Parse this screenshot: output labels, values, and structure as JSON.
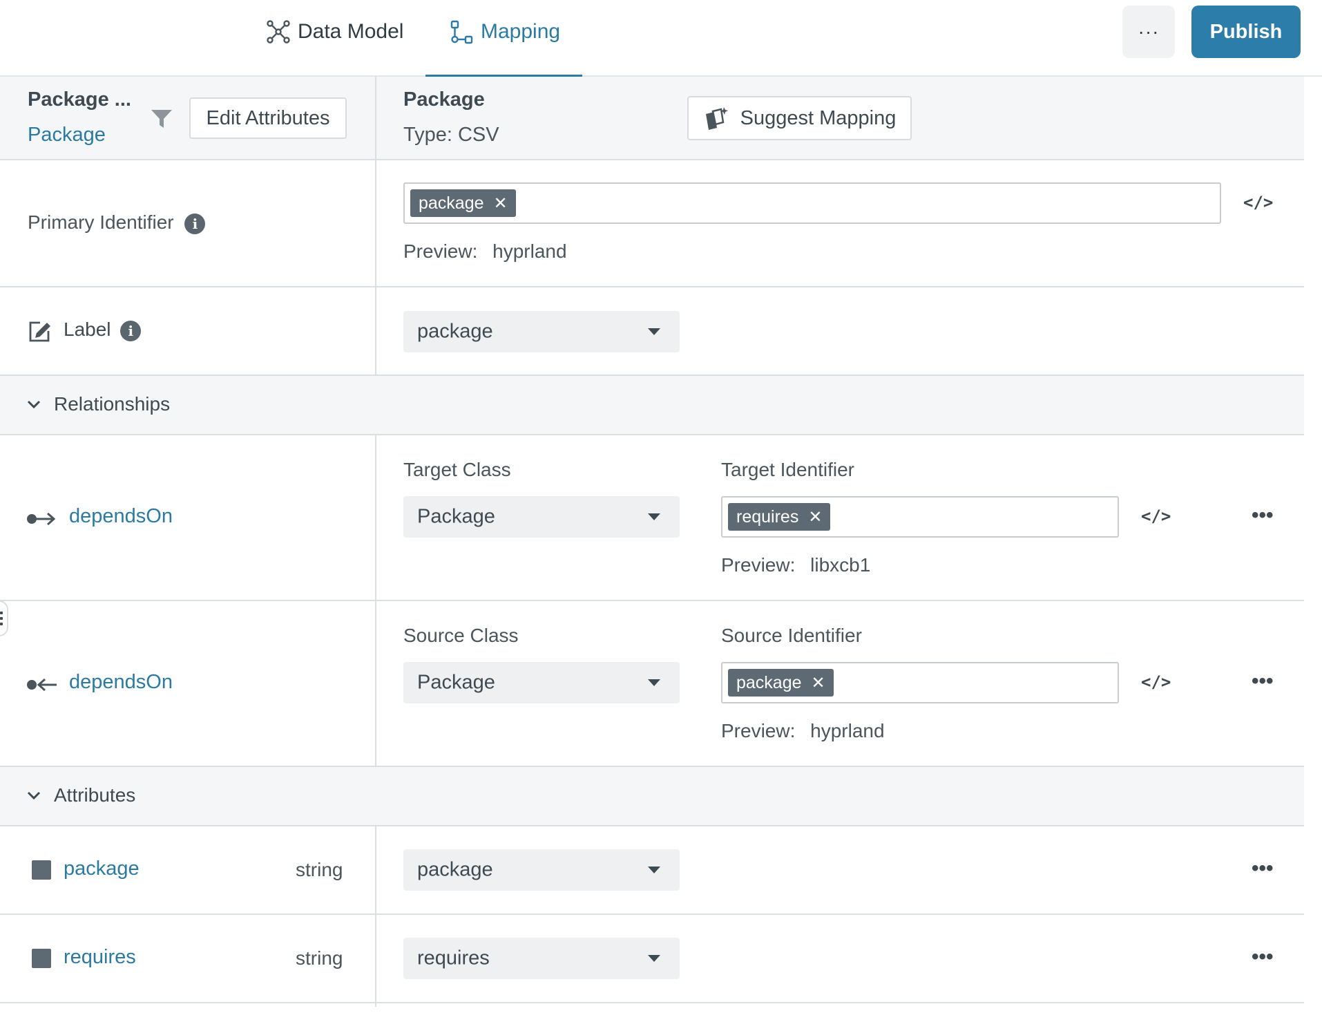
{
  "topbar": {
    "tabs": [
      {
        "label": "Data Model",
        "icon": "graph-network-icon",
        "active": false
      },
      {
        "label": "Mapping",
        "icon": "flow-mapping-icon",
        "active": true
      }
    ],
    "more_label": "···",
    "publish_label": "Publish",
    "accent_color": "#2c7da9"
  },
  "left_header": {
    "title": "Package ...",
    "subtitle": "Package",
    "edit_attributes_label": "Edit Attributes"
  },
  "right_header": {
    "title": "Package",
    "type_label": "Type: CSV",
    "suggest_label": "Suggest Mapping"
  },
  "primary_identifier": {
    "label": "Primary Identifier",
    "tag": "package",
    "preview_label": "Preview:",
    "preview_value": "hyprland"
  },
  "label_row": {
    "label": "Label",
    "dropdown_value": "package"
  },
  "relationships": {
    "section_label": "Relationships",
    "rows": [
      {
        "name": "dependsOn",
        "class_label": "Target Class",
        "class_value": "Package",
        "identifier_label": "Target Identifier",
        "tag": "requires",
        "preview_label": "Preview:",
        "preview_value": "libxcb1"
      },
      {
        "name": "dependsOn",
        "class_label": "Source Class",
        "class_value": "Package",
        "identifier_label": "Source Identifier",
        "tag": "package",
        "preview_label": "Preview:",
        "preview_value": "hyprland"
      }
    ]
  },
  "attributes": {
    "section_label": "Attributes",
    "rows": [
      {
        "name": "package",
        "type": "string",
        "dropdown_value": "package"
      },
      {
        "name": "requires",
        "type": "string",
        "dropdown_value": "requires"
      }
    ]
  },
  "icons": {
    "code": "</>",
    "dots": "•••",
    "tag_remove": "✕",
    "info": "i"
  }
}
